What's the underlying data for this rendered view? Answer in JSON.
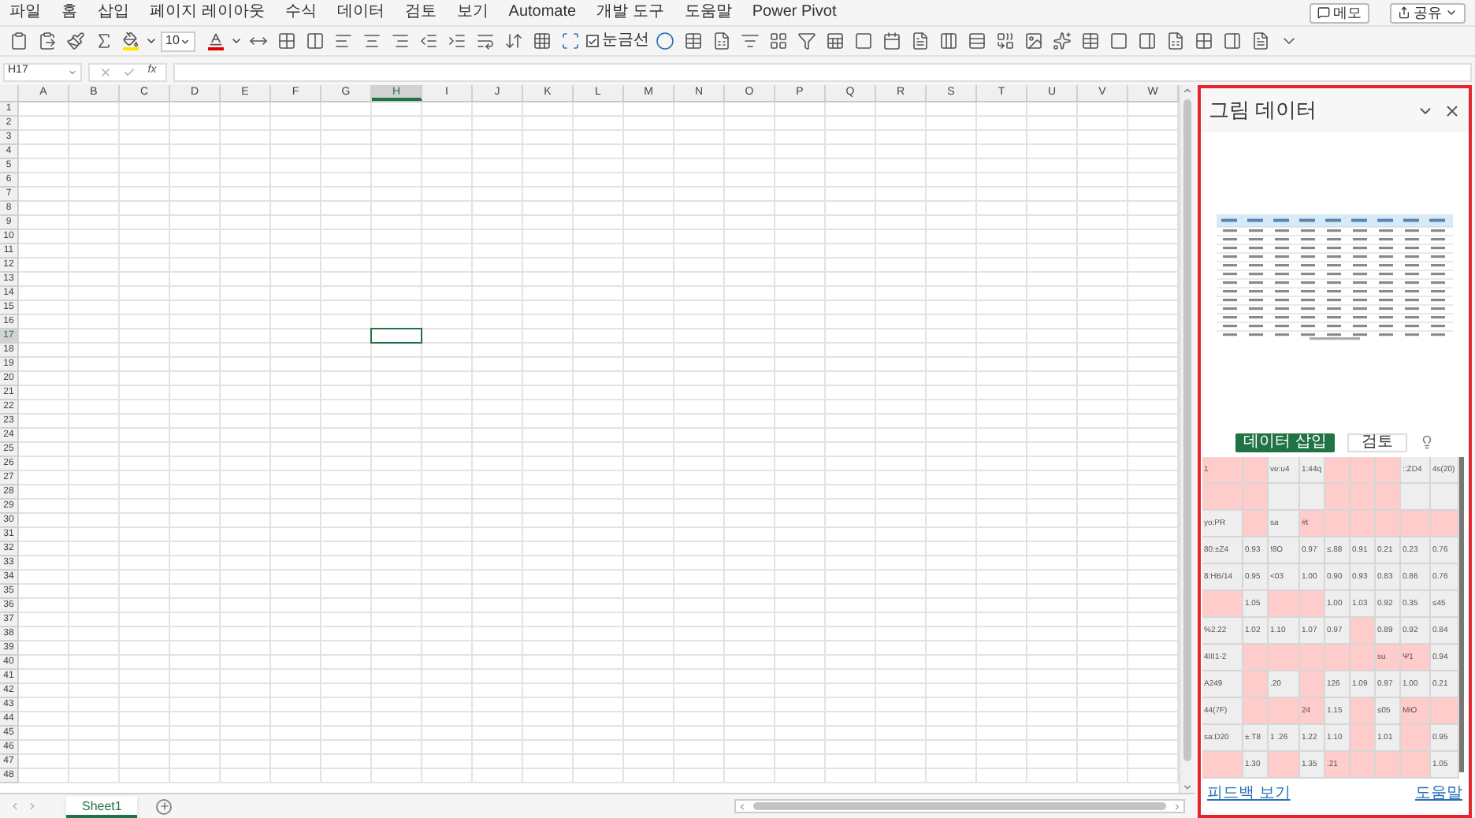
{
  "menu": {
    "items": [
      "파일",
      "홈",
      "삽입",
      "페이지 레이아웃",
      "수식",
      "데이터",
      "검토",
      "보기",
      "Automate",
      "개발 도구",
      "도움말",
      "Power Pivot"
    ],
    "memo_button": "메모",
    "share_button": "공유"
  },
  "toolbar": {
    "font_size": "10",
    "gridlines": {
      "label": "눈금선",
      "checked": true
    }
  },
  "formula_bar": {
    "name_box": "H17",
    "function_label": "fx"
  },
  "sheet": {
    "columns": [
      {
        "label": "A",
        "selected": false
      },
      {
        "label": "B",
        "selected": false
      },
      {
        "label": "C",
        "selected": false
      },
      {
        "label": "D",
        "selected": false
      },
      {
        "label": "E",
        "selected": false
      },
      {
        "label": "F",
        "selected": false
      },
      {
        "label": "G",
        "selected": false
      },
      {
        "label": "H",
        "selected": true
      },
      {
        "label": "I",
        "selected": false
      },
      {
        "label": "J",
        "selected": false
      },
      {
        "label": "K",
        "selected": false
      },
      {
        "label": "L",
        "selected": false
      },
      {
        "label": "M",
        "selected": false
      },
      {
        "label": "N",
        "selected": false
      },
      {
        "label": "O",
        "selected": false
      },
      {
        "label": "P",
        "selected": false
      },
      {
        "label": "Q",
        "selected": false
      },
      {
        "label": "R",
        "selected": false
      },
      {
        "label": "S",
        "selected": false
      },
      {
        "label": "T",
        "selected": false
      },
      {
        "label": "U",
        "selected": false
      },
      {
        "label": "V",
        "selected": false
      },
      {
        "label": "W",
        "selected": false
      }
    ],
    "rows": [
      {
        "label": "1",
        "selected": false
      },
      {
        "label": "2",
        "selected": false
      },
      {
        "label": "3",
        "selected": false
      },
      {
        "label": "4",
        "selected": false
      },
      {
        "label": "5",
        "selected": false
      },
      {
        "label": "6",
        "selected": false
      },
      {
        "label": "7",
        "selected": false
      },
      {
        "label": "8",
        "selected": false
      },
      {
        "label": "9",
        "selected": false
      },
      {
        "label": "10",
        "selected": false
      },
      {
        "label": "11",
        "selected": false
      },
      {
        "label": "12",
        "selected": false
      },
      {
        "label": "13",
        "selected": false
      },
      {
        "label": "14",
        "selected": false
      },
      {
        "label": "15",
        "selected": false
      },
      {
        "label": "16",
        "selected": false
      },
      {
        "label": "17",
        "selected": true
      },
      {
        "label": "18",
        "selected": false
      },
      {
        "label": "19",
        "selected": false
      },
      {
        "label": "20",
        "selected": false
      },
      {
        "label": "21",
        "selected": false
      },
      {
        "label": "22",
        "selected": false
      },
      {
        "label": "23",
        "selected": false
      },
      {
        "label": "24",
        "selected": false
      },
      {
        "label": "25",
        "selected": false
      },
      {
        "label": "26",
        "selected": false
      },
      {
        "label": "27",
        "selected": false
      },
      {
        "label": "28",
        "selected": false
      },
      {
        "label": "29",
        "selected": false
      },
      {
        "label": "30",
        "selected": false
      },
      {
        "label": "31",
        "selected": false
      },
      {
        "label": "32",
        "selected": false
      },
      {
        "label": "33",
        "selected": false
      },
      {
        "label": "34",
        "selected": false
      },
      {
        "label": "35",
        "selected": false
      },
      {
        "label": "36",
        "selected": false
      },
      {
        "label": "37",
        "selected": false
      },
      {
        "label": "38",
        "selected": false
      },
      {
        "label": "39",
        "selected": false
      },
      {
        "label": "40",
        "selected": false
      },
      {
        "label": "41",
        "selected": false
      },
      {
        "label": "42",
        "selected": false
      },
      {
        "label": "43",
        "selected": false
      },
      {
        "label": "44",
        "selected": false
      },
      {
        "label": "45",
        "selected": false
      },
      {
        "label": "46",
        "selected": false
      },
      {
        "label": "47",
        "selected": false
      },
      {
        "label": "48",
        "selected": false
      }
    ]
  },
  "sheet_tabs": [
    {
      "name": "Sheet1",
      "selected": true
    }
  ],
  "panel": {
    "title": "그림 데이터",
    "insert_button": "데이터 삽입",
    "review_button": "검토",
    "table": {
      "rows": [
        {
          "cells": [
            {
              "text": "1",
              "flagged": true
            },
            {
              "flagged": true
            },
            {
              "text": "ve:u4",
              "flagged": false
            },
            {
              "text": "1:44q",
              "flagged": false
            },
            {
              "flagged": true
            },
            {
              "flagged": true
            },
            {
              "flagged": true
            },
            {
              "text": "::ZD4",
              "flagged": false
            },
            {
              "text": "4s(20)",
              "flagged": false
            }
          ]
        },
        {
          "cells": [
            {
              "flagged": true
            },
            {
              "flagged": true
            },
            {
              "flagged": false
            },
            {
              "flagged": false
            },
            {
              "flagged": true
            },
            {
              "flagged": true
            },
            {
              "flagged": true
            },
            {
              "flagged": false
            },
            {
              "flagged": false
            }
          ]
        },
        {
          "cells": [
            {
              "text": "yo:PR",
              "flagged": false
            },
            {
              "flagged": true
            },
            {
              "text": "sa",
              "flagged": false
            },
            {
              "text": "#t",
              "flagged": true
            },
            {
              "flagged": true
            },
            {
              "flagged": true
            },
            {
              "flagged": true
            },
            {
              "flagged": true
            },
            {
              "flagged": true
            }
          ]
        },
        {
          "cells": [
            {
              "text": "80:±Z4",
              "flagged": false
            },
            {
              "text": "0.93",
              "flagged": false
            },
            {
              "text": "!8O",
              "flagged": false
            },
            {
              "text": "0.97",
              "flagged": false
            },
            {
              "text": "≤.88",
              "flagged": false
            },
            {
              "text": "0.91",
              "flagged": false
            },
            {
              "text": "0.21",
              "flagged": false
            },
            {
              "text": "0.23",
              "flagged": false
            },
            {
              "text": "0.76",
              "flagged": false
            }
          ]
        },
        {
          "cells": [
            {
              "text": "8:HB/14",
              "flagged": false
            },
            {
              "text": "0.95",
              "flagged": false
            },
            {
              "text": "<03",
              "flagged": false
            },
            {
              "text": "1.00",
              "flagged": false
            },
            {
              "text": "0.90",
              "flagged": false
            },
            {
              "text": "0.93",
              "flagged": false
            },
            {
              "text": "0.83",
              "flagged": false
            },
            {
              "text": "0.86",
              "flagged": false
            },
            {
              "text": "0.76",
              "flagged": false
            }
          ]
        },
        {
          "cells": [
            {
              "flagged": true
            },
            {
              "text": "1.05",
              "flagged": false
            },
            {
              "flagged": true
            },
            {
              "flagged": true
            },
            {
              "text": "1.00",
              "flagged": false
            },
            {
              "text": "1.03",
              "flagged": false
            },
            {
              "text": "0.92",
              "flagged": false
            },
            {
              "text": "0.35",
              "flagged": false
            },
            {
              "text": "≤45",
              "flagged": false
            }
          ]
        },
        {
          "cells": [
            {
              "text": "%2.22",
              "flagged": false
            },
            {
              "text": "1.02",
              "flagged": false
            },
            {
              "text": "1.10",
              "flagged": false
            },
            {
              "text": "1.07",
              "flagged": false
            },
            {
              "text": "0.97",
              "flagged": false
            },
            {
              "flagged": true
            },
            {
              "text": "0.89",
              "flagged": false
            },
            {
              "text": "0.92",
              "flagged": false
            },
            {
              "text": "0.84",
              "flagged": false
            }
          ]
        },
        {
          "cells": [
            {
              "text": "4III1-2",
              "flagged": false
            },
            {
              "flagged": true
            },
            {
              "flagged": true
            },
            {
              "flagged": true
            },
            {
              "flagged": true
            },
            {
              "flagged": true
            },
            {
              "text": "su",
              "flagged": true
            },
            {
              "text": "Ψ1",
              "flagged": true
            },
            {
              "text": "0.94",
              "flagged": false
            }
          ]
        },
        {
          "cells": [
            {
              "text": "A249",
              "flagged": false
            },
            {
              "flagged": true
            },
            {
              "text": ".20",
              "flagged": false
            },
            {
              "flagged": true
            },
            {
              "text": "126",
              "flagged": false
            },
            {
              "text": "1.09",
              "flagged": false
            },
            {
              "text": "0.97",
              "flagged": false
            },
            {
              "text": "1.00",
              "flagged": false
            },
            {
              "text": "0.21",
              "flagged": false
            }
          ]
        },
        {
          "cells": [
            {
              "text": "44(7F)",
              "flagged": false
            },
            {
              "flagged": true
            },
            {
              "flagged": true
            },
            {
              "text": "24",
              "flagged": true
            },
            {
              "text": "1.15",
              "flagged": false
            },
            {
              "flagged": true
            },
            {
              "text": "≤05",
              "flagged": false
            },
            {
              "text": "MiO",
              "flagged": true
            },
            {
              "flagged": true
            }
          ]
        },
        {
          "cells": [
            {
              "text": "sa:D20",
              "flagged": false
            },
            {
              "text": "±.T8",
              "flagged": false
            },
            {
              "text": "1 .26",
              "flagged": false
            },
            {
              "text": "1.22",
              "flagged": false
            },
            {
              "text": "1.10",
              "flagged": false
            },
            {
              "flagged": true
            },
            {
              "text": "1.01",
              "flagged": false
            },
            {
              "flagged": true
            },
            {
              "text": "0.95",
              "flagged": false
            }
          ]
        },
        {
          "cells": [
            {
              "flagged": true
            },
            {
              "text": "1.30",
              "flagged": false
            },
            {
              "flagged": true
            },
            {
              "text": "1.35",
              "flagged": false
            },
            {
              "text": ".21",
              "flagged": true
            },
            {
              "flagged": true
            },
            {
              "flagged": true
            },
            {
              "flagged": true
            },
            {
              "text": "1.05",
              "flagged": false
            }
          ]
        }
      ]
    },
    "footer_left": "피드백 보기",
    "footer_right": "도움말"
  }
}
